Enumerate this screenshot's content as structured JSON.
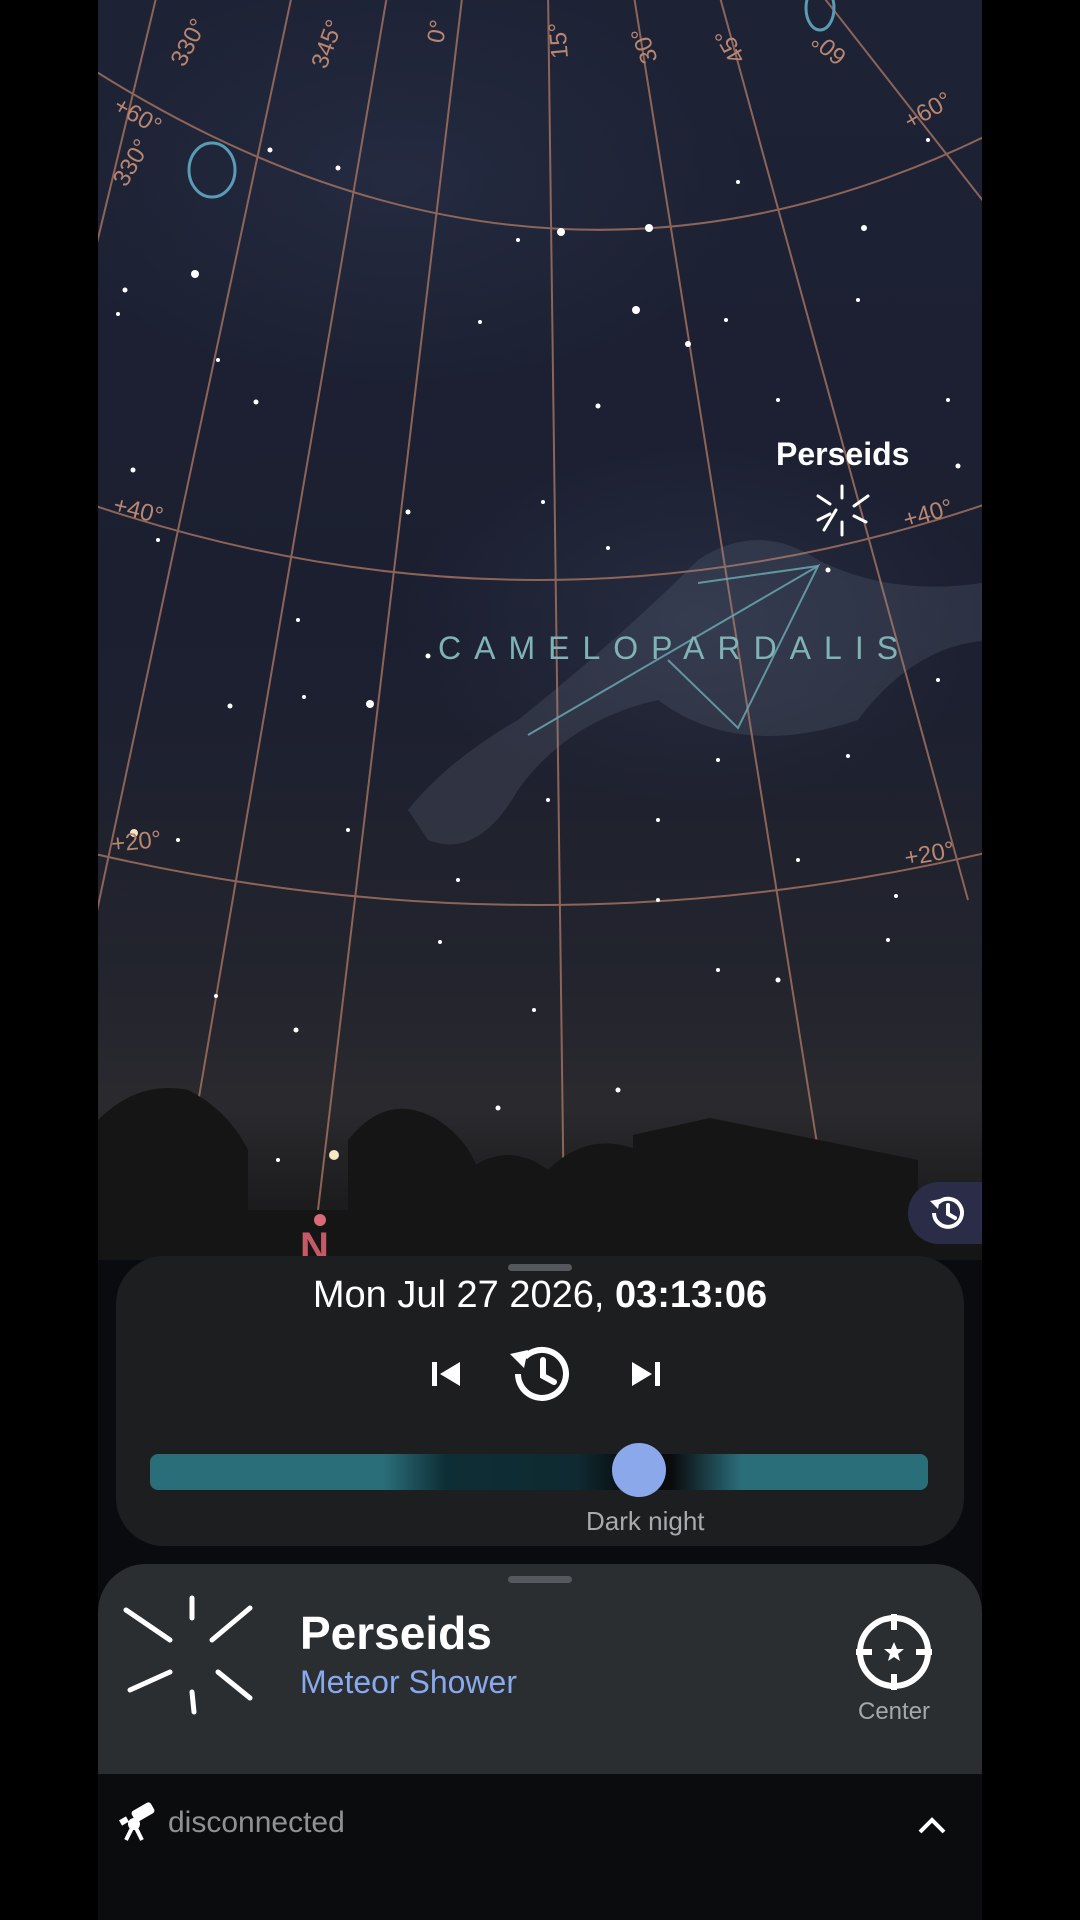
{
  "sky": {
    "constellation": "CAMELOPARDALIS",
    "object_label": "Perseids",
    "direction": "N",
    "grid_labels": {
      "ra_330": "330°",
      "ra_345": "345°",
      "ra_0": "0°",
      "ra_15": "15°",
      "ra_30": "30°",
      "ra_45": "45°",
      "ra_60": "60°",
      "dec_60_left": "+60°",
      "ra_330_left": "330°",
      "dec_60_right": "+60°",
      "dec_40_left": "+40°",
      "dec_40_right": "+40°",
      "dec_20_left": "+20°",
      "dec_20_right": "+20°"
    }
  },
  "time_panel": {
    "date": "Mon Jul 27 2026,",
    "time": "03:13:06",
    "slider_value": 0.63,
    "slider_label": "Dark night"
  },
  "info_panel": {
    "title": "Perseids",
    "subtitle": "Meteor Shower",
    "center_label": "Center"
  },
  "status_bar": {
    "connection": "disconnected"
  },
  "colors": {
    "accent": "#8aa8ea",
    "constellation": "#7fb3b4",
    "grid": "#b98672",
    "north": "#c55a66"
  }
}
